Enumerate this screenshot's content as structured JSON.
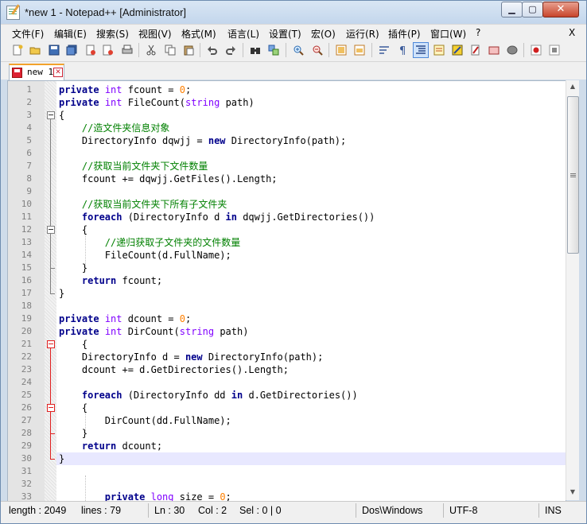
{
  "window": {
    "title": "*new 1 - Notepad++ [Administrator]",
    "min_glyph": "▁",
    "max_glyph": "▢",
    "close_glyph": "✕"
  },
  "menu": {
    "items": [
      "文件(F)",
      "编辑(E)",
      "搜索(S)",
      "视图(V)",
      "格式(M)",
      "语言(L)",
      "设置(T)",
      "宏(O)",
      "运行(R)",
      "插件(P)",
      "窗口(W)",
      "?"
    ],
    "close": "X"
  },
  "toolbar": {
    "buttons": [
      "new",
      "open",
      "save",
      "save-all",
      "close",
      "close-all",
      "print",
      "cut",
      "copy",
      "paste",
      "undo",
      "redo",
      "find",
      "replace",
      "zoom-in",
      "zoom-out",
      "sync-v",
      "sync-h",
      "word-wrap",
      "all-chars",
      "indent-guide",
      "doc-map",
      "function-list",
      "folder-workspace",
      "monitor",
      "record-macro",
      "stop-record"
    ],
    "active": "indent-guide"
  },
  "tab": {
    "label": "new 1"
  },
  "editor": {
    "lines": [
      {
        "n": "1",
        "parts": [
          [
            "kw",
            "private"
          ],
          [
            "",
            " "
          ],
          [
            "ty",
            "int"
          ],
          [
            "",
            " fcount = "
          ],
          [
            "num",
            "0"
          ],
          [
            "",
            ";"
          ]
        ]
      },
      {
        "n": "2",
        "parts": [
          [
            "kw",
            "private"
          ],
          [
            "",
            " "
          ],
          [
            "ty",
            "int"
          ],
          [
            "",
            " FileCount("
          ],
          [
            "ty",
            "string"
          ],
          [
            "",
            " path)"
          ]
        ]
      },
      {
        "n": "3",
        "parts": [
          [
            "",
            "{"
          ]
        ]
      },
      {
        "n": "4",
        "parts": [
          [
            "",
            "    "
          ],
          [
            "cm",
            "//造文件夹信息对象"
          ]
        ]
      },
      {
        "n": "5",
        "parts": [
          [
            "",
            "    DirectoryInfo dqwjj = "
          ],
          [
            "kw",
            "new"
          ],
          [
            "",
            " DirectoryInfo(path);"
          ]
        ]
      },
      {
        "n": "6",
        "parts": []
      },
      {
        "n": "7",
        "parts": [
          [
            "",
            "    "
          ],
          [
            "cm",
            "//获取当前文件夹下文件数量"
          ]
        ]
      },
      {
        "n": "8",
        "parts": [
          [
            "",
            "    fcount += dqwjj.GetFiles().Length;"
          ]
        ]
      },
      {
        "n": "9",
        "parts": []
      },
      {
        "n": "10",
        "parts": [
          [
            "",
            "    "
          ],
          [
            "cm",
            "//获取当前文件夹下所有子文件夹"
          ]
        ]
      },
      {
        "n": "11",
        "parts": [
          [
            "",
            "    "
          ],
          [
            "kw",
            "foreach"
          ],
          [
            "",
            " (DirectoryInfo d "
          ],
          [
            "kw",
            "in"
          ],
          [
            "",
            " dqwjj.GetDirectories())"
          ]
        ]
      },
      {
        "n": "12",
        "parts": [
          [
            "",
            "    {"
          ]
        ]
      },
      {
        "n": "13",
        "parts": [
          [
            "",
            "        "
          ],
          [
            "cm",
            "//递归获取子文件夹的文件数量"
          ]
        ]
      },
      {
        "n": "14",
        "parts": [
          [
            "",
            "        FileCount(d.FullName);"
          ]
        ]
      },
      {
        "n": "15",
        "parts": [
          [
            "",
            "    }"
          ]
        ]
      },
      {
        "n": "16",
        "parts": [
          [
            "",
            "    "
          ],
          [
            "kw",
            "return"
          ],
          [
            "",
            " fcount;"
          ]
        ]
      },
      {
        "n": "17",
        "parts": [
          [
            "",
            "}"
          ]
        ]
      },
      {
        "n": "18",
        "parts": []
      },
      {
        "n": "19",
        "parts": [
          [
            "kw",
            "private"
          ],
          [
            "",
            " "
          ],
          [
            "ty",
            "int"
          ],
          [
            "",
            " dcount = "
          ],
          [
            "num",
            "0"
          ],
          [
            "",
            ";"
          ]
        ]
      },
      {
        "n": "20",
        "parts": [
          [
            "kw",
            "private"
          ],
          [
            "",
            " "
          ],
          [
            "ty",
            "int"
          ],
          [
            "",
            " DirCount("
          ],
          [
            "ty",
            "string"
          ],
          [
            "",
            " path)"
          ]
        ]
      },
      {
        "n": "21",
        "parts": [
          [
            "",
            "    {"
          ]
        ]
      },
      {
        "n": "22",
        "parts": [
          [
            "",
            "    DirectoryInfo d = "
          ],
          [
            "kw",
            "new"
          ],
          [
            "",
            " DirectoryInfo(path);"
          ]
        ]
      },
      {
        "n": "23",
        "parts": [
          [
            "",
            "    dcount += d.GetDirectories().Length;"
          ]
        ]
      },
      {
        "n": "24",
        "parts": []
      },
      {
        "n": "25",
        "parts": [
          [
            "",
            "    "
          ],
          [
            "kw",
            "foreach"
          ],
          [
            "",
            " (DirectoryInfo dd "
          ],
          [
            "kw",
            "in"
          ],
          [
            "",
            " d.GetDirectories())"
          ]
        ]
      },
      {
        "n": "26",
        "parts": [
          [
            "",
            "    {"
          ]
        ]
      },
      {
        "n": "27",
        "parts": [
          [
            "",
            "        DirCount(dd.FullName);"
          ]
        ]
      },
      {
        "n": "28",
        "parts": [
          [
            "",
            "    }"
          ]
        ]
      },
      {
        "n": "29",
        "parts": [
          [
            "",
            "    "
          ],
          [
            "kw",
            "return"
          ],
          [
            "",
            " dcount;"
          ]
        ]
      },
      {
        "n": "30",
        "parts": [
          [
            "",
            "}"
          ]
        ]
      },
      {
        "n": "31",
        "parts": []
      },
      {
        "n": "32",
        "parts": []
      },
      {
        "n": "33",
        "parts": [
          [
            "",
            "        "
          ],
          [
            "kw",
            "private"
          ],
          [
            "",
            " "
          ],
          [
            "ty",
            "long"
          ],
          [
            "",
            " size = "
          ],
          [
            "num",
            "0"
          ],
          [
            "",
            ";"
          ]
        ]
      }
    ]
  },
  "status": {
    "length": "length : 2049",
    "lines": "lines : 79",
    "ln": "Ln : 30",
    "col": "Col : 2",
    "sel": "Sel : 0 | 0",
    "eol": "Dos\\Windows",
    "encoding": "UTF-8",
    "mode": "INS"
  }
}
